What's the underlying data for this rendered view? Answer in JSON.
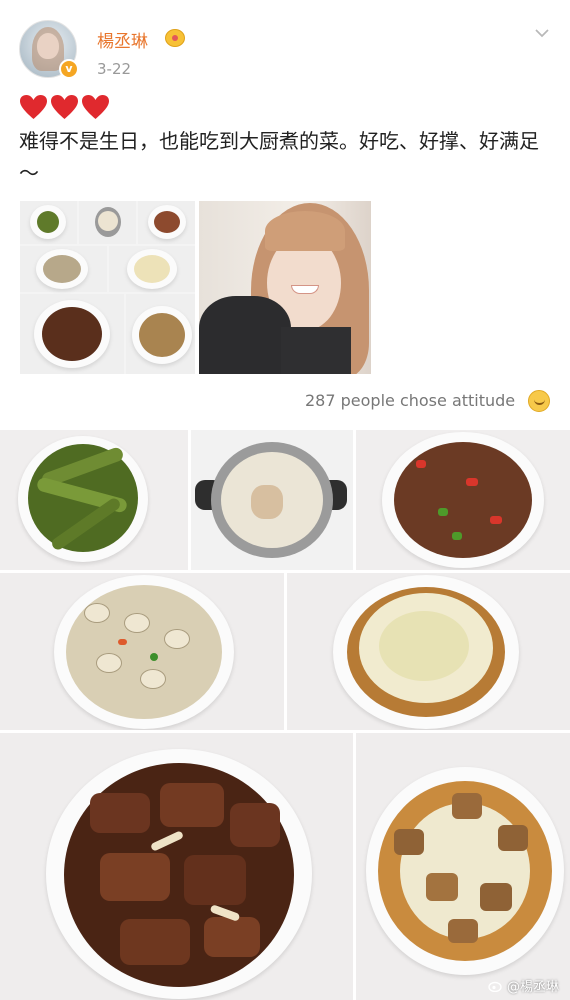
{
  "post": {
    "username": "楊丞琳",
    "date": "3-22",
    "text": "难得不是生日，也能吃到大厨煮的菜。好吃、好撑、好满足～"
  },
  "reactions": {
    "attitude_text": "287 people chose attitude"
  },
  "watermark": {
    "text": "@楊丞琳"
  },
  "colors": {
    "username": "#e8762d",
    "heart": "#e0292e",
    "verified": "#f5a623"
  },
  "icons": {
    "verified": "v-badge-icon",
    "vip": "crown-icon",
    "menu": "chevron-down-icon",
    "emoji": "grin-emoji-icon"
  }
}
